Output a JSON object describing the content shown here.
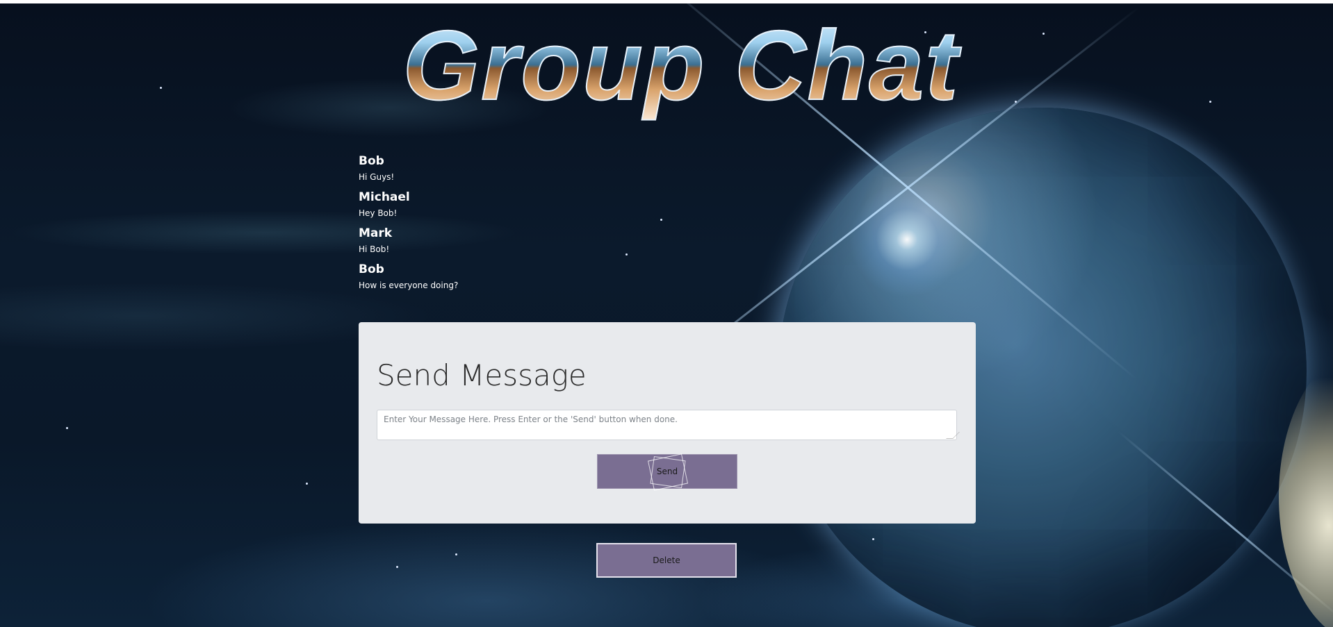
{
  "page": {
    "title": "Group Chat"
  },
  "messages": [
    {
      "author": "Bob",
      "text": "Hi Guys!"
    },
    {
      "author": "Michael",
      "text": "Hey Bob!"
    },
    {
      "author": "Mark",
      "text": "Hi Bob!"
    },
    {
      "author": "Bob",
      "text": "How is everyone doing?"
    }
  ],
  "composer": {
    "heading": "Send Message",
    "placeholder": "Enter Your Message Here. Press Enter or the 'Send' button when done.",
    "value": "",
    "send_label": "Send"
  },
  "actions": {
    "delete_label": "Delete"
  },
  "colors": {
    "button": "#7a6e92",
    "panel": "#e8eaed",
    "message_text": "#ffffff"
  }
}
